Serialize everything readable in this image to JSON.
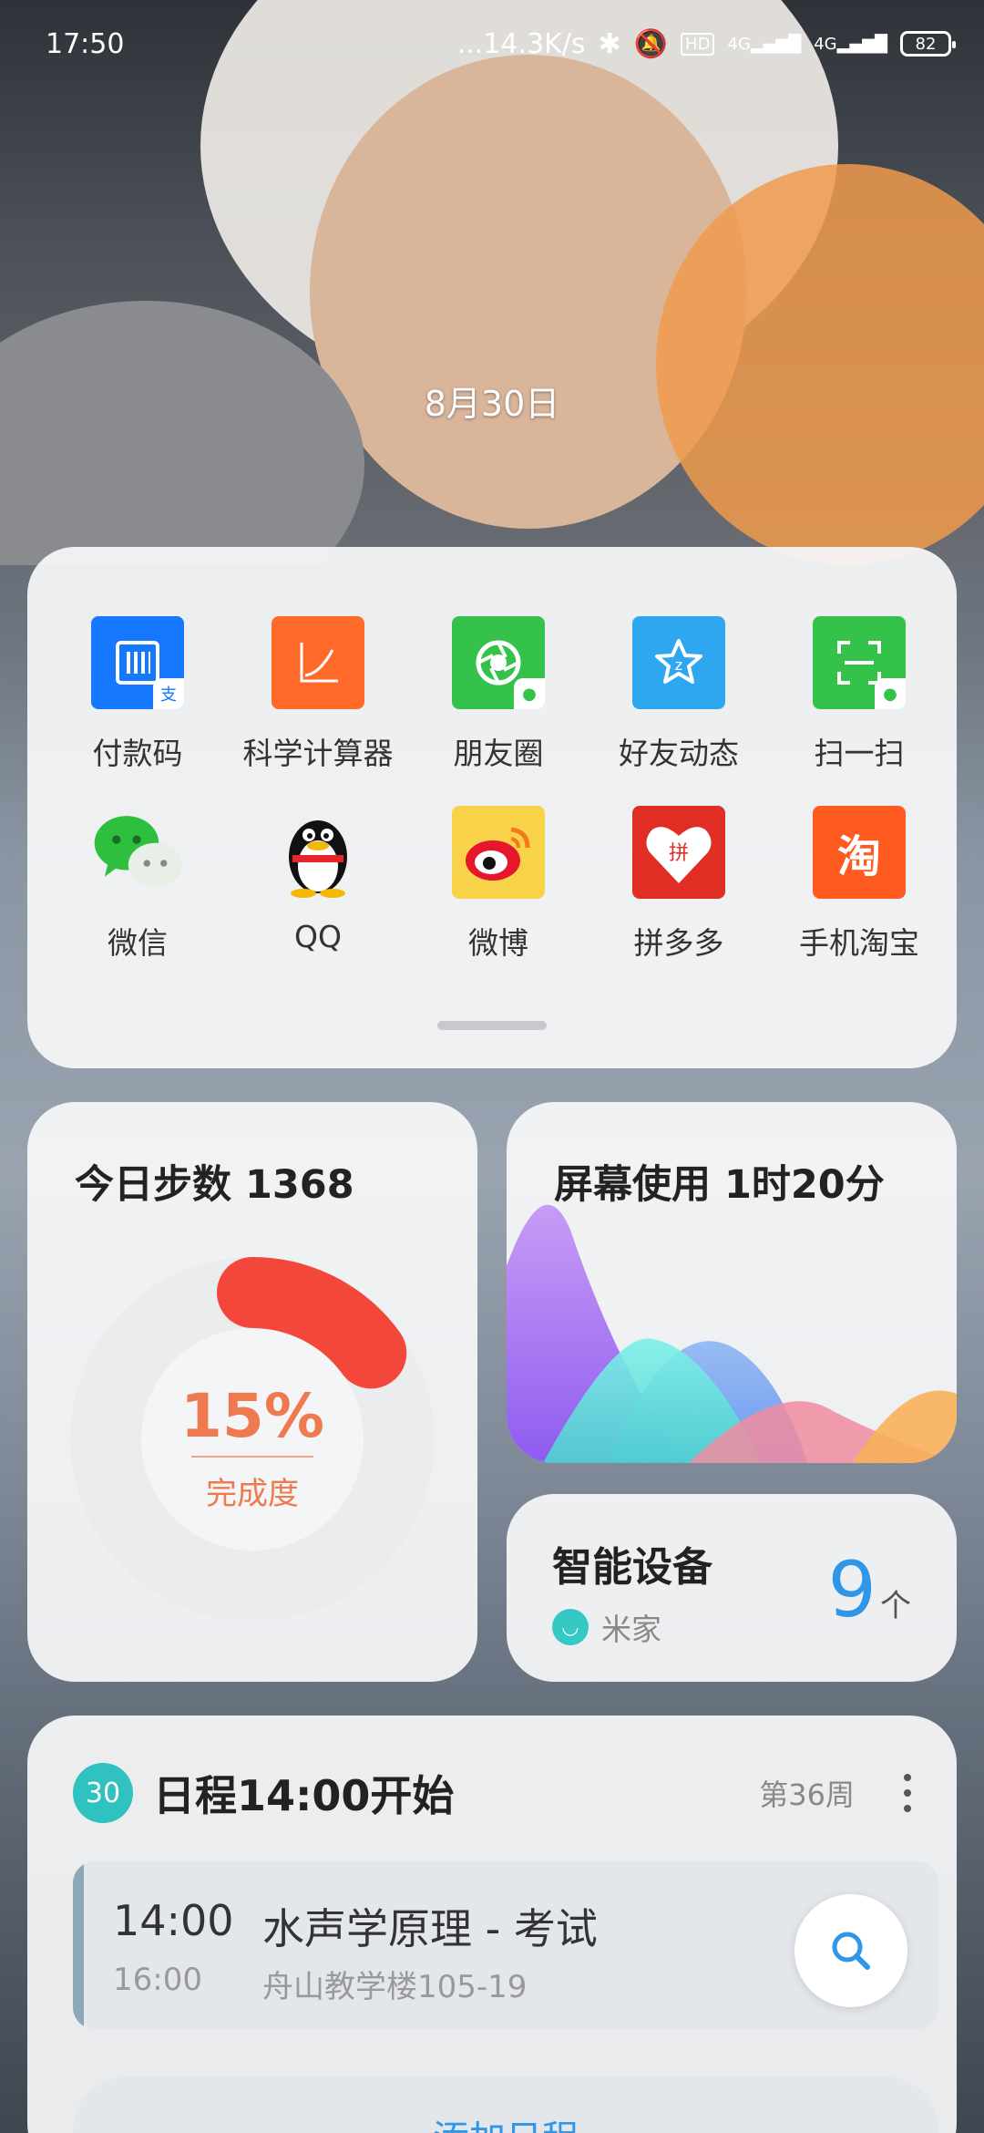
{
  "status_bar": {
    "time": "17:50",
    "network_speed": "...14.3K/s",
    "signal_1": "4G",
    "signal_2": "4G",
    "battery": "82",
    "icons": [
      "bluetooth-icon",
      "mute-icon",
      "hd-icon",
      "signal-icon",
      "signal-icon",
      "battery-icon"
    ]
  },
  "lockscreen": {
    "date": "8月30日"
  },
  "apps": [
    {
      "label": "付款码",
      "icon": "alipay-paycode-icon",
      "color": "#1677ff"
    },
    {
      "label": "科学计算器",
      "icon": "calculator-icon",
      "color": "#ff6a2a"
    },
    {
      "label": "朋友圈",
      "icon": "moments-icon",
      "color": "#35c24a"
    },
    {
      "label": "好友动态",
      "icon": "qzone-icon",
      "color": "#2fa6f0"
    },
    {
      "label": "扫一扫",
      "icon": "scan-icon",
      "color": "#35c24a"
    },
    {
      "label": "微信",
      "icon": "wechat-icon",
      "color": "#35c24a"
    },
    {
      "label": "QQ",
      "icon": "qq-icon",
      "color": "#111111"
    },
    {
      "label": "微博",
      "icon": "weibo-icon",
      "color": "#e6162d"
    },
    {
      "label": "拼多多",
      "icon": "pinduoduo-icon",
      "color": "#e02e24"
    },
    {
      "label": "手机淘宝",
      "icon": "taobao-icon",
      "color": "#ff5a1f"
    }
  ],
  "steps": {
    "title": "今日步数 1368",
    "percent": "15%",
    "progress": 0.15,
    "label": "完成度"
  },
  "screen_time": {
    "title": "屏幕使用 1时20分"
  },
  "smart_devices": {
    "title": "智能设备",
    "brand": "米家",
    "count": "9",
    "unit": "个"
  },
  "schedule": {
    "day": "30",
    "title": "日程14:00开始",
    "week": "第36周",
    "event": {
      "start": "14:00",
      "end": "16:00",
      "title": "水声学原理 - 考试",
      "place": "舟山教学楼105-19"
    },
    "add_label": "添加日程"
  },
  "colors": {
    "accent": "#2f96e8",
    "steps_ring": "#f2473a",
    "percent_text": "#f07a4f",
    "badge_teal": "#30c2c0"
  }
}
